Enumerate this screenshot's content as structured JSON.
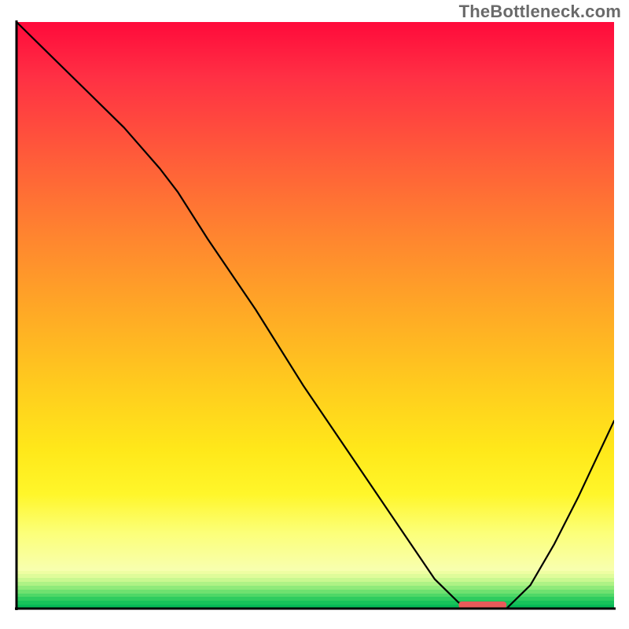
{
  "watermark": "TheBottleneck.com",
  "chart_data": {
    "type": "line",
    "title": "",
    "xlabel": "",
    "ylabel": "",
    "xlim": [
      0,
      100
    ],
    "ylim": [
      0,
      100
    ],
    "grid": false,
    "series": [
      {
        "name": "bottleneck-curve",
        "x": [
          0,
          6,
          12,
          18,
          24,
          27,
          32,
          40,
          48,
          56,
          64,
          70,
          74,
          78,
          82,
          86,
          90,
          94,
          100
        ],
        "y": [
          100,
          94,
          88,
          82,
          75,
          71,
          63,
          51,
          38,
          26,
          14,
          5,
          1,
          0,
          0,
          4,
          11,
          19,
          32
        ]
      }
    ],
    "annotations": [
      {
        "name": "optimal-marker",
        "shape": "capsule",
        "x_range": [
          74,
          82
        ],
        "y": 0.6,
        "color": "#e85a5a"
      }
    ],
    "background": {
      "type": "vertical-gradient",
      "stops": [
        {
          "pct": 0,
          "color": "#ff0a3b"
        },
        {
          "pct": 24,
          "color": "#ff5a3a"
        },
        {
          "pct": 52,
          "color": "#ffa726"
        },
        {
          "pct": 78,
          "color": "#ffe81a"
        },
        {
          "pct": 93,
          "color": "#f8ffb0"
        },
        {
          "pct": 100,
          "color": "#07b957"
        }
      ]
    }
  }
}
